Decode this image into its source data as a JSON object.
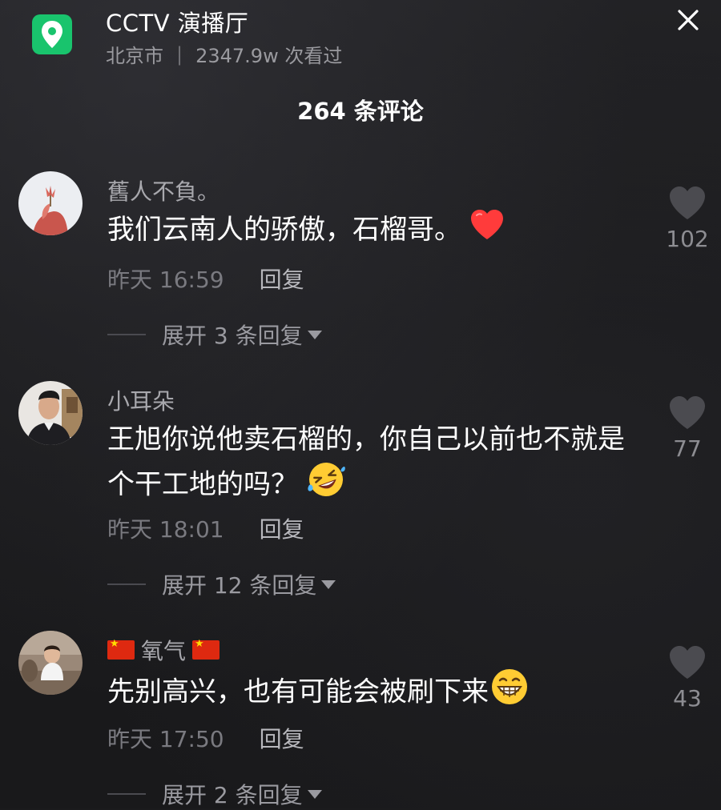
{
  "header": {
    "location_icon": "location-pin-icon",
    "title": "CCTV 演播厅",
    "city": "北京市",
    "separator": "|",
    "views": "2347.9w 次看过",
    "close_icon": "close-icon"
  },
  "comments_header": {
    "count_label": "264 条评论"
  },
  "comments": [
    {
      "username": "舊人不負。",
      "text": "我们云南人的骄傲，石榴哥。",
      "emoji": "red-heart-icon",
      "time": "昨天 16:59",
      "reply_label": "回复",
      "expand_label": "展开 3 条回复",
      "likes": "102"
    },
    {
      "username": "小耳朵",
      "text": "王旭你说他卖石榴的，你自己以前也不就是个干工地的吗？",
      "emoji": "rolling-laughing-emoji-icon",
      "time": "昨天 18:01",
      "reply_label": "回复",
      "expand_label": "展开 12 条回复",
      "likes": "77"
    },
    {
      "username_prefix_icon": "china-flag-icon",
      "username": "氧气",
      "username_suffix_icon": "china-flag-icon",
      "text": "先别高兴，也有可能会被刷下来",
      "emoji": "grinning-emoji-icon",
      "time": "昨天 17:50",
      "reply_label": "回复",
      "expand_label": "展开 2 条回复",
      "likes": "43"
    }
  ],
  "colors": {
    "background": "#1b1b1d",
    "location_badge": "#19c46d",
    "username": "#a8a8ad",
    "meta": "#7a7a80",
    "heart_red": "#ff3b3b"
  }
}
